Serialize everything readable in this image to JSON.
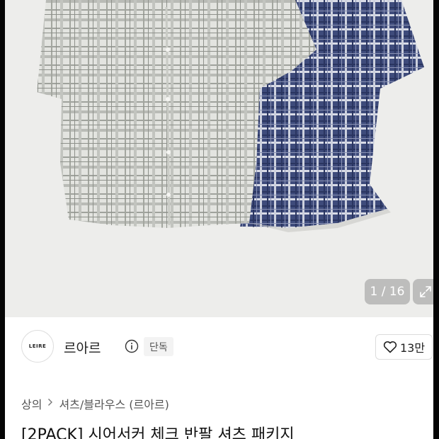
{
  "gallery": {
    "counter_current": "1",
    "counter_total": "16",
    "counter_text": "1 / 16"
  },
  "brand": {
    "logo_text": "LEIRE",
    "name": "르아르",
    "badge": "단독"
  },
  "like": {
    "count": "13만"
  },
  "breadcrumb": {
    "items": [
      "상의",
      "셔츠/블라우스 (르아르)"
    ]
  },
  "product": {
    "title": "[2PACK] 시어서커 체크 반팔 셔츠 패키지"
  },
  "icons": {
    "info": "info-icon",
    "heart": "heart-icon",
    "expand": "expand-icon",
    "chevron": "chevron-right-icon"
  },
  "colors": {
    "hero_background": "#ededeb",
    "grey_shirt": "#d2d3cf",
    "navy_shirt": "#3c4a78"
  }
}
